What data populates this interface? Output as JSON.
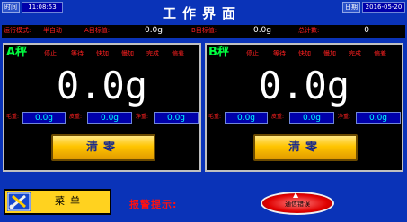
{
  "header": {
    "time_label": "时间",
    "time_value": "11:08:53",
    "title": "工作界面",
    "date_label": "日期",
    "date_value": "2016-05-20"
  },
  "info_row": {
    "run_mode_label": "运行模式:",
    "run_mode_value": "半自动",
    "a_target_label": "A目标值:",
    "a_target_value": "0.0g",
    "b_target_label": "B目标值:",
    "b_target_value": "0.0g",
    "total_count_label": "总计数:",
    "total_count_value": "0"
  },
  "scales": [
    {
      "name": "A秤",
      "statuses": [
        "停止",
        "等待",
        "快加",
        "慢加",
        "完成",
        "偏差"
      ],
      "weight": "0.0g",
      "gross_label": "毛重:",
      "gross_value": "0.0g",
      "tare_label": "皮重:",
      "tare_value": "0.0g",
      "net_label": "净重:",
      "net_value": "0.0g",
      "clear_label": "清零"
    },
    {
      "name": "B秤",
      "statuses": [
        "停止",
        "等待",
        "快加",
        "慢加",
        "完成",
        "偏差"
      ],
      "weight": "0.0g",
      "gross_label": "毛重:",
      "gross_value": "0.0g",
      "tare_label": "皮重:",
      "tare_value": "0.0g",
      "net_label": "净重:",
      "net_value": "0.0g",
      "clear_label": "清零"
    }
  ],
  "footer": {
    "menu_label": "菜单",
    "alarm_label": "报警提示:",
    "alarm_status": "通信错误"
  },
  "colors": {
    "background": "#0a33b8",
    "status_red": "#ff2020",
    "scale_name_green": "#00ff40",
    "value_cyan": "#00ffff",
    "button_yellow": "#ffc400"
  },
  "icons": {
    "menu": "tools-icon",
    "alarm": "alarm-logo-icon"
  }
}
